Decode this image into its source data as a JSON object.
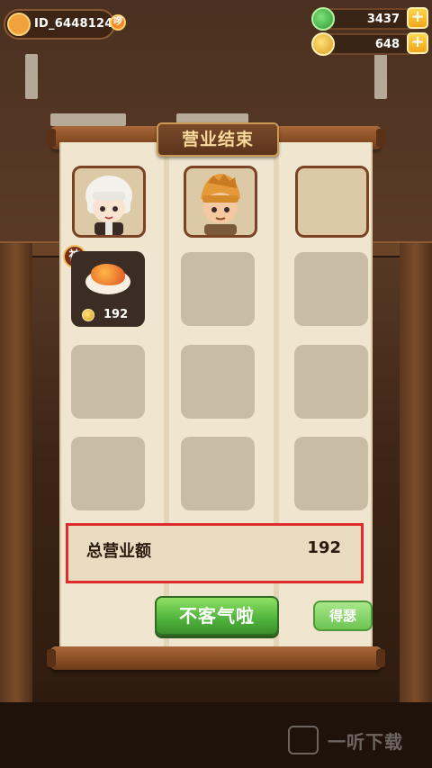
{
  "player": {
    "id": "ID_6448124",
    "flag": "啰"
  },
  "resources": [
    {
      "name": "gem",
      "value": "3437",
      "icon": "gem-icon"
    },
    {
      "name": "coin",
      "value": "648",
      "icon": "coin-icon"
    }
  ],
  "panel": {
    "title": "营业结束",
    "special_badge": "神",
    "dish": {
      "icon": "dish-icon",
      "price": "192"
    },
    "total": {
      "label": "总营业额",
      "value": "192"
    },
    "buttons": {
      "primary": "不客气啦",
      "secondary": "得瑟"
    }
  },
  "watermark": {
    "text": "一听下载"
  },
  "colors": {
    "highlight_box": "#e12b2b",
    "primary_button": "#4fb23c",
    "paper": "#f0e6cf"
  }
}
